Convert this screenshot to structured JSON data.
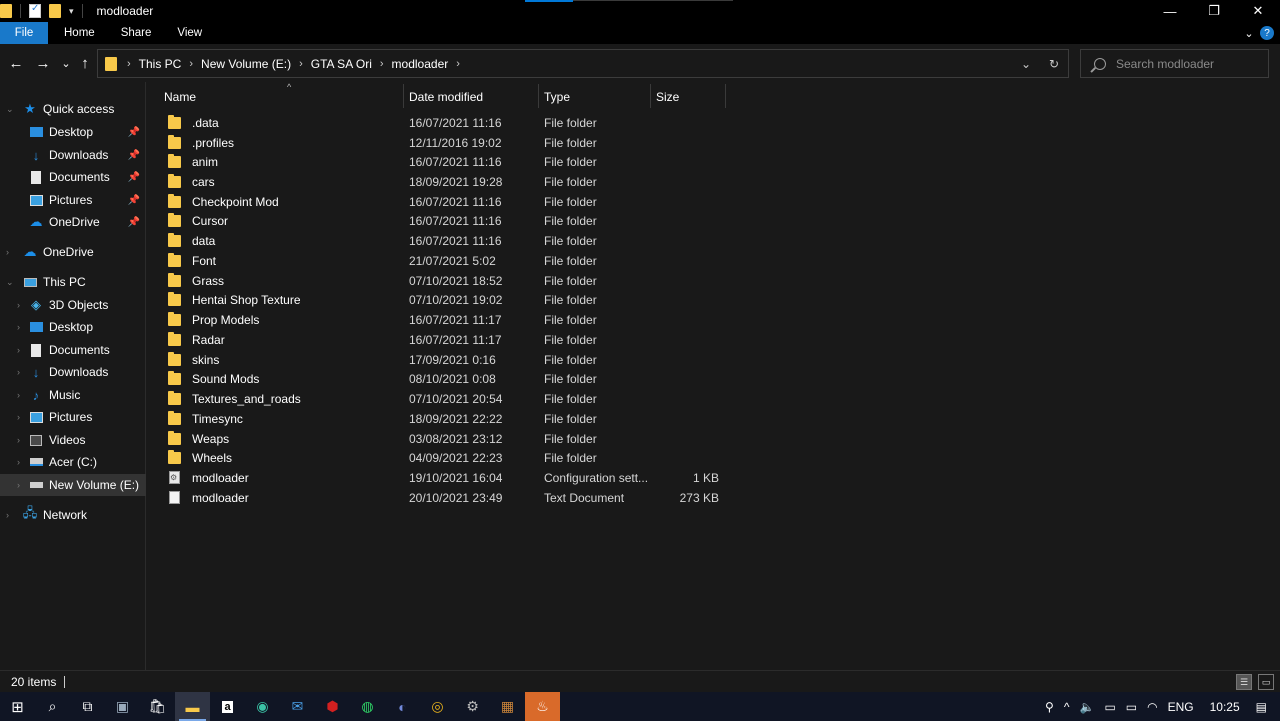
{
  "window": {
    "title": "modloader",
    "controls": {
      "minimize": "—",
      "maximize": "❐",
      "close": "✕"
    }
  },
  "ribbon": {
    "tabs": [
      "File",
      "Home",
      "Share",
      "View"
    ],
    "expand": "⌄",
    "help": "?"
  },
  "nav_buttons": {
    "back": "←",
    "forward": "→",
    "recent": "⌄",
    "up": "↑"
  },
  "breadcrumb": [
    "This PC",
    "New Volume (E:)",
    "GTA SA Ori",
    "modloader"
  ],
  "address_controls": {
    "dropdown": "⌄",
    "refresh": "↻"
  },
  "search": {
    "placeholder": "Search modloader"
  },
  "nav_pane": {
    "quick_access": "Quick access",
    "quick_items": [
      {
        "label": "Desktop",
        "icon": "desktop-icon"
      },
      {
        "label": "Downloads",
        "icon": "downloads-icon"
      },
      {
        "label": "Documents",
        "icon": "documents-icon"
      },
      {
        "label": "Pictures",
        "icon": "pictures-icon"
      },
      {
        "label": "OneDrive",
        "icon": "onedrive-icon"
      }
    ],
    "onedrive": "OneDrive",
    "this_pc": "This PC",
    "pc_items": [
      {
        "label": "3D Objects",
        "icon": "3d-objects-icon"
      },
      {
        "label": "Desktop",
        "icon": "desktop-icon"
      },
      {
        "label": "Documents",
        "icon": "documents-icon"
      },
      {
        "label": "Downloads",
        "icon": "downloads-icon"
      },
      {
        "label": "Music",
        "icon": "music-icon"
      },
      {
        "label": "Pictures",
        "icon": "pictures-icon"
      },
      {
        "label": "Videos",
        "icon": "videos-icon"
      },
      {
        "label": "Acer (C:)",
        "icon": "drive-icon"
      },
      {
        "label": "New Volume (E:)",
        "icon": "drive-icon"
      }
    ],
    "network": "Network"
  },
  "columns": {
    "name": "Name",
    "date": "Date modified",
    "type": "Type",
    "size": "Size",
    "sort_indicator": "^"
  },
  "files": [
    {
      "name": ".data",
      "date": "16/07/2021 11:16",
      "type": "File folder",
      "size": "",
      "kind": "folder"
    },
    {
      "name": ".profiles",
      "date": "12/11/2016 19:02",
      "type": "File folder",
      "size": "",
      "kind": "folder"
    },
    {
      "name": "anim",
      "date": "16/07/2021 11:16",
      "type": "File folder",
      "size": "",
      "kind": "folder"
    },
    {
      "name": "cars",
      "date": "18/09/2021 19:28",
      "type": "File folder",
      "size": "",
      "kind": "folder"
    },
    {
      "name": "Checkpoint Mod",
      "date": "16/07/2021 11:16",
      "type": "File folder",
      "size": "",
      "kind": "folder"
    },
    {
      "name": "Cursor",
      "date": "16/07/2021 11:16",
      "type": "File folder",
      "size": "",
      "kind": "folder"
    },
    {
      "name": "data",
      "date": "16/07/2021 11:16",
      "type": "File folder",
      "size": "",
      "kind": "folder"
    },
    {
      "name": "Font",
      "date": "21/07/2021 5:02",
      "type": "File folder",
      "size": "",
      "kind": "folder"
    },
    {
      "name": "Grass",
      "date": "07/10/2021 18:52",
      "type": "File folder",
      "size": "",
      "kind": "folder"
    },
    {
      "name": "Hentai Shop Texture",
      "date": "07/10/2021 19:02",
      "type": "File folder",
      "size": "",
      "kind": "folder"
    },
    {
      "name": "Prop Models",
      "date": "16/07/2021 11:17",
      "type": "File folder",
      "size": "",
      "kind": "folder"
    },
    {
      "name": "Radar",
      "date": "16/07/2021 11:17",
      "type": "File folder",
      "size": "",
      "kind": "folder"
    },
    {
      "name": "skins",
      "date": "17/09/2021 0:16",
      "type": "File folder",
      "size": "",
      "kind": "folder"
    },
    {
      "name": "Sound Mods",
      "date": "08/10/2021 0:08",
      "type": "File folder",
      "size": "",
      "kind": "folder"
    },
    {
      "name": "Textures_and_roads",
      "date": "07/10/2021 20:54",
      "type": "File folder",
      "size": "",
      "kind": "folder"
    },
    {
      "name": "Timesync",
      "date": "18/09/2021 22:22",
      "type": "File folder",
      "size": "",
      "kind": "folder"
    },
    {
      "name": "Weaps",
      "date": "03/08/2021 23:12",
      "type": "File folder",
      "size": "",
      "kind": "folder"
    },
    {
      "name": "Wheels",
      "date": "04/09/2021 22:23",
      "type": "File folder",
      "size": "",
      "kind": "folder"
    },
    {
      "name": "modloader",
      "date": "19/10/2021 16:04",
      "type": "Configuration sett...",
      "size": "1 KB",
      "kind": "config"
    },
    {
      "name": "modloader",
      "date": "20/10/2021 23:49",
      "type": "Text Document",
      "size": "273 KB",
      "kind": "text"
    }
  ],
  "status": {
    "items": "20 items"
  },
  "taskbar": {
    "apps": [
      "start-icon",
      "search-icon",
      "task-view-icon",
      "photos-icon",
      "store-icon",
      "file-explorer-icon",
      "amazon-icon",
      "edge-icon",
      "mail-icon",
      "security-icon",
      "whatsapp-icon",
      "discord-icon",
      "chrome-icon",
      "steam-icon",
      "game-icon",
      "media-icon"
    ],
    "tray": {
      "language": "ENG",
      "time": "10:25"
    }
  },
  "colors": {
    "background": "#191919",
    "accent": "#1979ca",
    "folder": "#f8c94a",
    "taskbar": "#101524"
  }
}
